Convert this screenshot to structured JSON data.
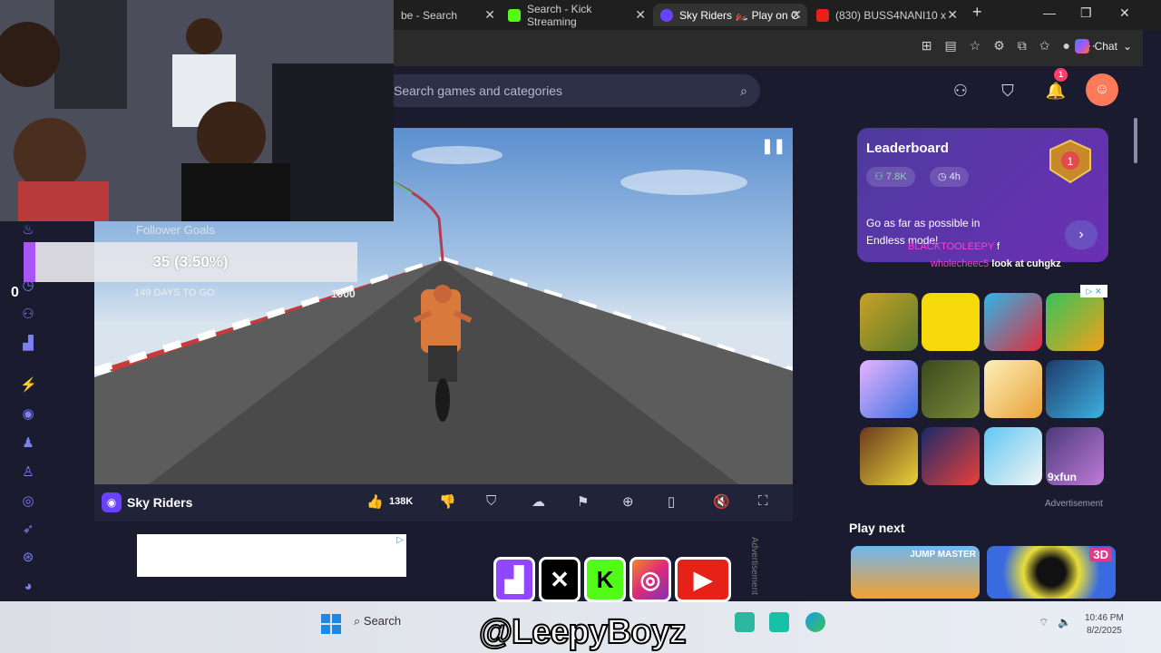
{
  "browser": {
    "tabs": [
      {
        "label": "be - Search"
      },
      {
        "label": "Search - Kick Streaming"
      },
      {
        "label": "Sky Riders 🏍️ Play on C"
      },
      {
        "label": "(830) BUSS4NANI10 x"
      }
    ],
    "chat_label": "Chat"
  },
  "site": {
    "search_placeholder": "Search games and categories",
    "notification_count": "1"
  },
  "game": {
    "title": "Sky Riders",
    "likes": "138K"
  },
  "leaderboard": {
    "title": "Leaderboard",
    "players": "7.8K",
    "duration": "4h",
    "description": "Go as far as possible in Endless mode!"
  },
  "sidebar": {
    "ad_label": "Advertisement",
    "play_next_title": "Play next",
    "play_next_tiles": [
      "JUMP MASTER",
      "3D"
    ],
    "tile_logo": "9xfun"
  },
  "advertisement_vertical": "Advertisement",
  "stream_overlay": {
    "goal_title": "Follower Goals",
    "goal_value": "35 (3.50%)",
    "goal_progress": 0.035,
    "goal_days": "149 DAYS TO GO",
    "goal_target": "1000",
    "left_counter": "0",
    "chat": [
      {
        "user": "BLACKTOOLEEPY",
        "message": "f"
      },
      {
        "user": "wholecheec5",
        "message": "look at cuhgkz"
      }
    ],
    "handle": "@LeepyBoyz",
    "socials": [
      "twitch",
      "x",
      "kick",
      "instagram",
      "youtube"
    ]
  },
  "taskbar": {
    "search_label": "Search",
    "time": "10:46 PM",
    "date": "8/2/2025"
  },
  "colors": {
    "accent": "#6842ff",
    "bg": "#1a1b2e",
    "leaderboard": "#5a35a8",
    "chat_user": "#ff3fd2"
  }
}
